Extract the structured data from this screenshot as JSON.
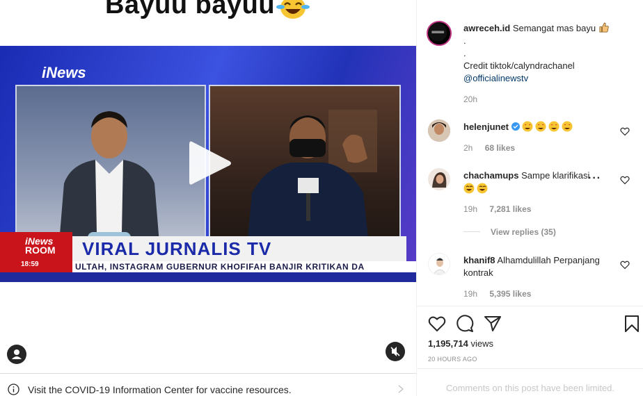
{
  "post": {
    "caption_title": "Bayuu bayuu",
    "video": {
      "brand": "iNews",
      "logo_line1": "iNews",
      "logo_line2": "ROOM",
      "logo_time": "18:59",
      "headline": "VIRAL JURNALIS TV",
      "ticker": "ULTAH, INSTAGRAM GUBERNUR KHOFIFAH BANJIR KRITIKAN DA"
    },
    "covid_notice": "Visit the COVID-19 Information Center for vaccine resources."
  },
  "owner": {
    "username": "awreceh.id",
    "caption": "Semangat mas bayu",
    "dot1": ".",
    "dot2": ".",
    "credit": "Credit tiktok/calyndrachanel",
    "mention": "@officialinewstv",
    "time": "20h"
  },
  "comments": [
    {
      "username": "helenjunet",
      "text": "",
      "time": "2h",
      "likes": "68 likes"
    },
    {
      "username": "chachamups",
      "text": "Sampe klarifikasi",
      "time": "19h",
      "likes": "7,281 likes",
      "replies": "View replies (35)"
    },
    {
      "username": "khanif8",
      "text": "Alhamdulillah Perpanjang kontrak",
      "time": "19h",
      "likes": "5,395 likes"
    }
  ],
  "stats": {
    "views_count": "1,195,714",
    "views_label": "views",
    "ago": "20 HOURS AGO"
  },
  "footer": {
    "limited": "Comments on this post have been limited."
  },
  "icons": {
    "play": "play-icon",
    "mute": "muted-speaker-icon",
    "tag": "user-tag-icon",
    "like": "heart-icon",
    "comment": "comment-bubble-icon",
    "share": "paper-plane-icon",
    "save": "bookmark-icon",
    "info": "info-icon"
  },
  "colors": {
    "link": "#00376b",
    "muted": "#8e8e8e",
    "tv_blue": "#1b2aa8",
    "tv_red": "#c8141a"
  }
}
